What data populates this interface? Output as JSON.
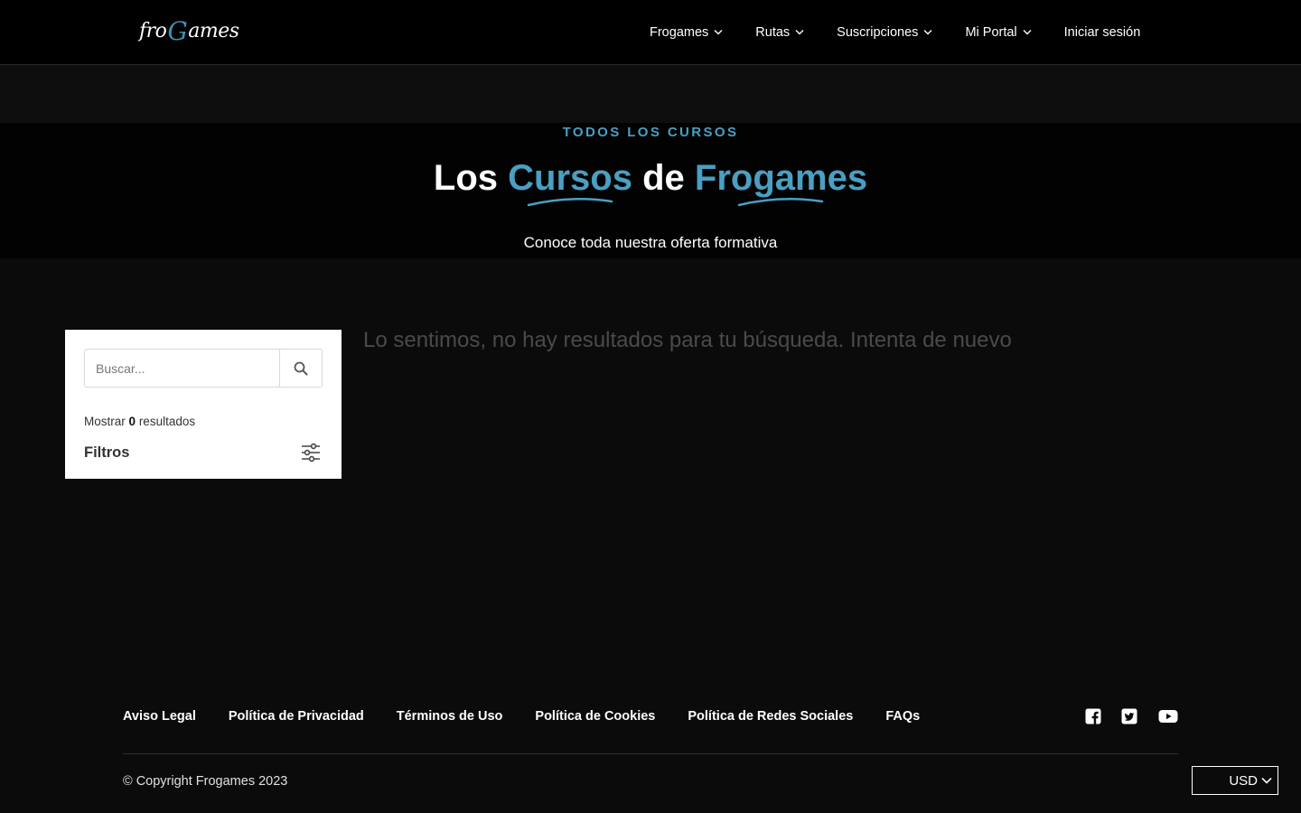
{
  "header": {
    "logo_text": "froGames",
    "nav": [
      {
        "label": "Frogames",
        "has_dropdown": true
      },
      {
        "label": "Rutas",
        "has_dropdown": true
      },
      {
        "label": "Suscripciones",
        "has_dropdown": true
      },
      {
        "label": "Mi Portal",
        "has_dropdown": true
      },
      {
        "label": "Iniciar sesión",
        "has_dropdown": false
      }
    ]
  },
  "hero": {
    "kicker": "TODOS LOS CURSOS",
    "title_part1": "Los",
    "title_accent1": "Cursos",
    "title_part2": "de",
    "title_accent2": "Frogames",
    "subtitle": "Conoce toda nuestra oferta formativa",
    "accent_color": "#4a9fc2"
  },
  "sidebar": {
    "search_placeholder": "Buscar...",
    "search_icon": "search-icon",
    "results_prefix": "Mostrar",
    "results_count": "0",
    "results_suffix": "resultados",
    "filters_label": "Filtros",
    "filters_icon": "sliders-icon"
  },
  "main": {
    "empty_message": "Lo sentimos, no hay resultados para tu búsqueda. Intenta de nuevo"
  },
  "footer": {
    "links": [
      "Aviso Legal",
      "Política de Privacidad",
      "Términos de Uso",
      "Política de Cookies",
      "Política de Redes Sociales",
      "FAQs"
    ],
    "social": [
      "facebook-icon",
      "twitter-icon",
      "youtube-icon"
    ],
    "copyright": "© Copyright Frogames 2023",
    "currency": "USD"
  }
}
